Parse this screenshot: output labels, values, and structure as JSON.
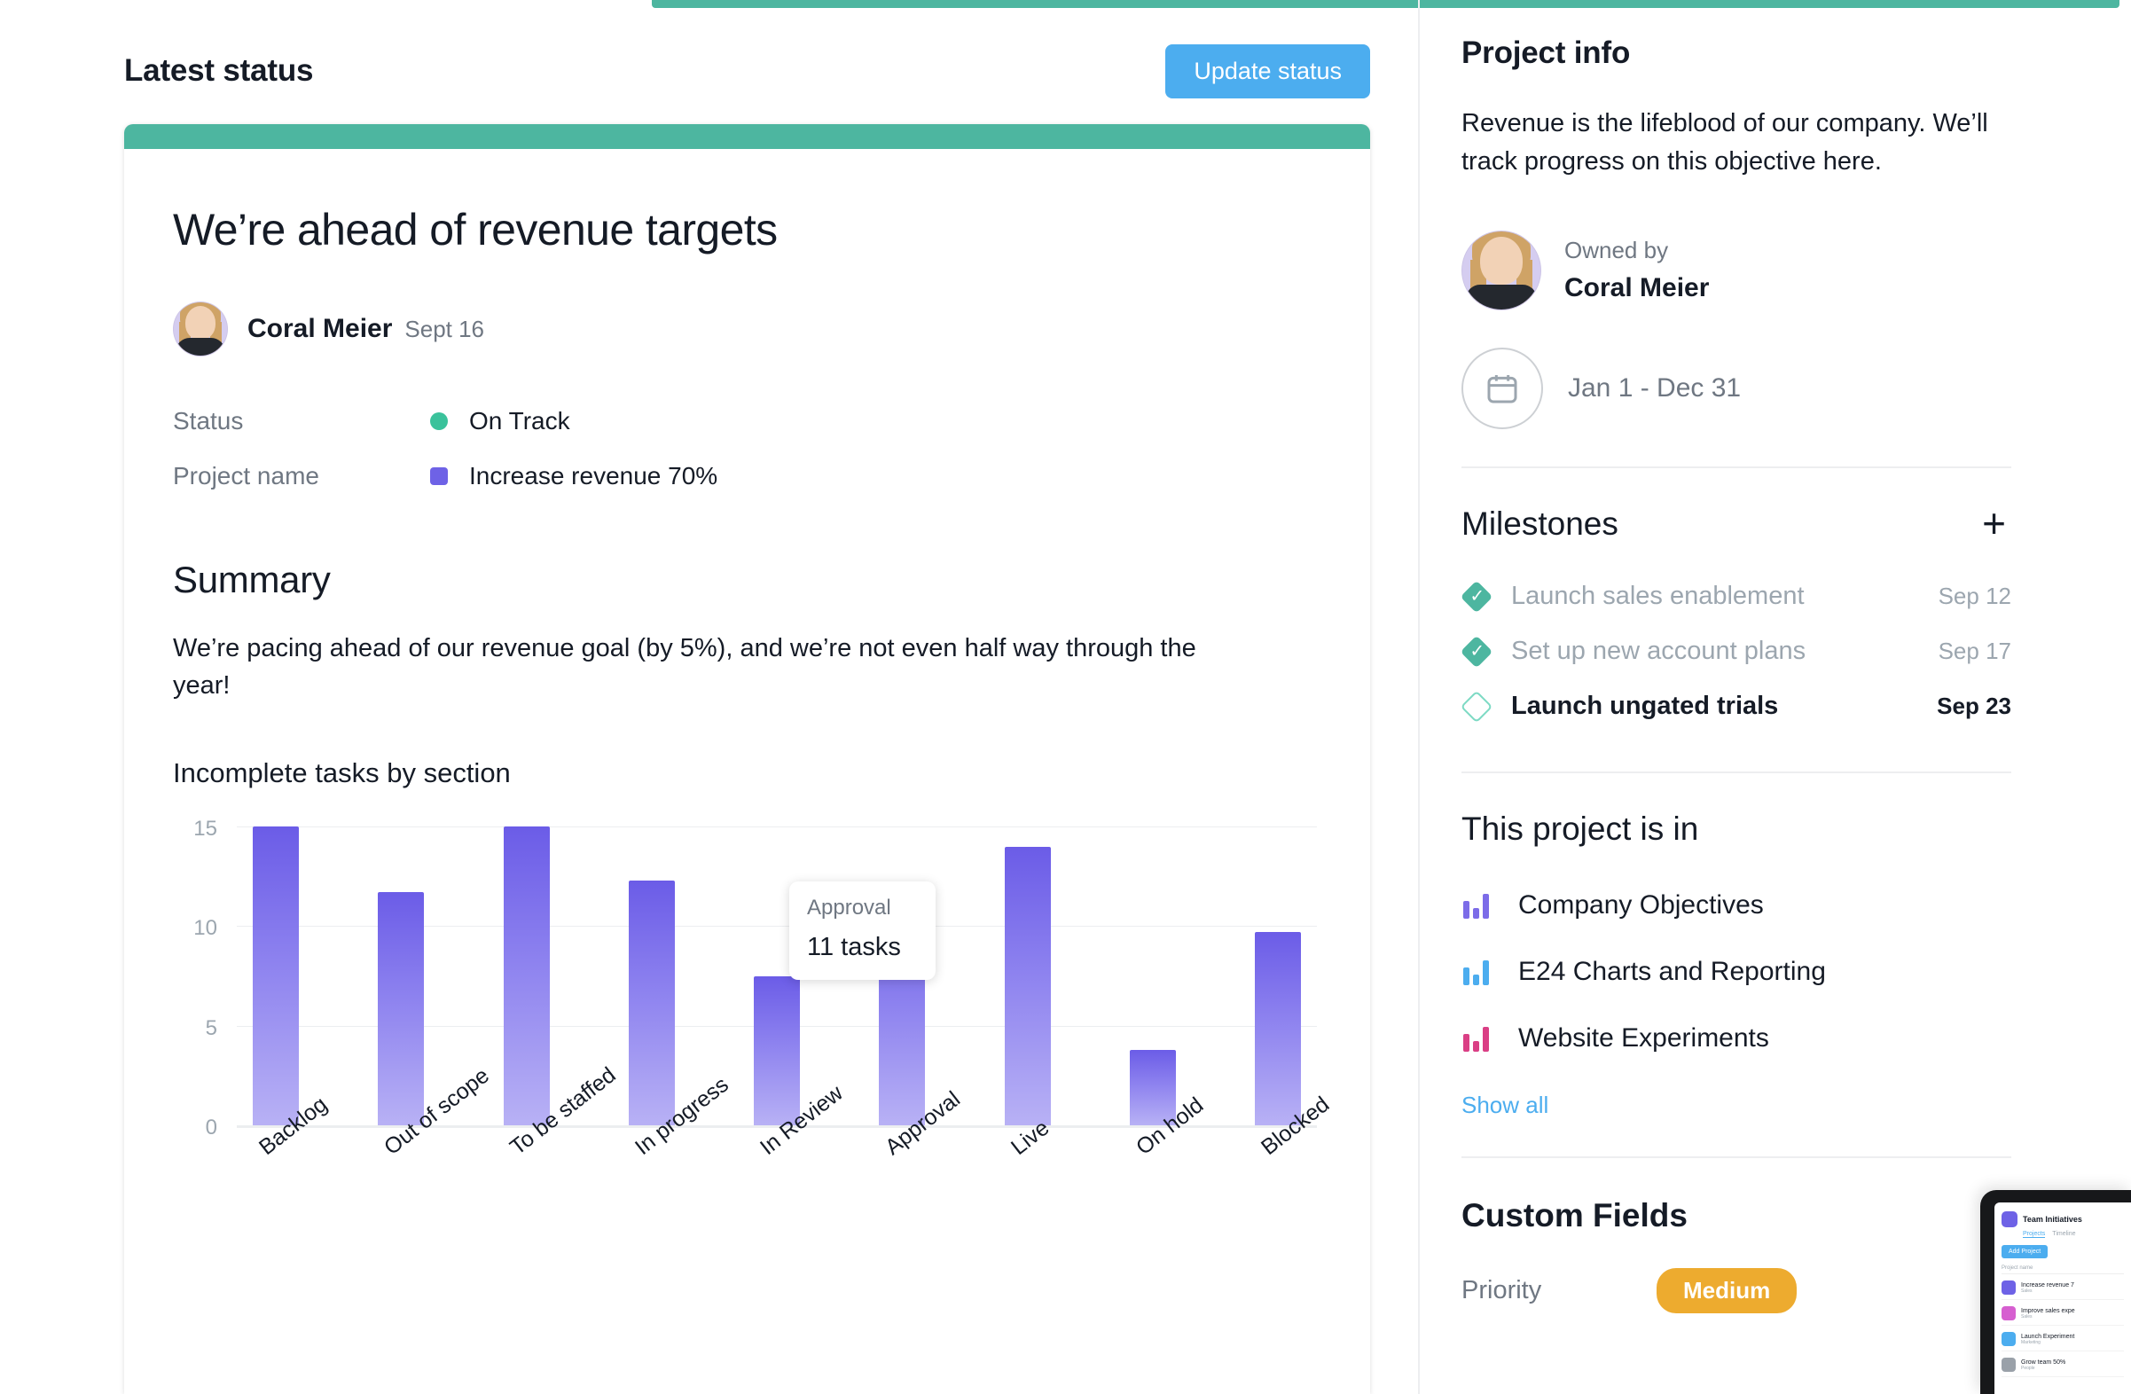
{
  "main": {
    "header_title": "Latest status",
    "update_button": "Update status",
    "card": {
      "title": "We’re ahead of revenue targets",
      "author": "Coral Meier",
      "date": "Sept 16",
      "meta": [
        {
          "label": "Status",
          "value": "On Track",
          "marker": "dot",
          "color": "#3ac29b"
        },
        {
          "label": "Project name",
          "value": "Increase revenue 70%",
          "marker": "square",
          "color": "#6e62e6"
        }
      ],
      "summary_heading": "Summary",
      "summary_text": "We’re pacing ahead of our revenue goal (by 5%), and we’re not even half way through the year!",
      "chart_heading": "Incomplete tasks by section"
    }
  },
  "chart_data": {
    "type": "bar",
    "title": "Incomplete tasks by section",
    "categories": [
      "Backlog",
      "Out of scope",
      "To be staffed",
      "In progress",
      "In Review",
      "Approval",
      "Live",
      "On hold",
      "Blocked"
    ],
    "values": [
      15,
      11.7,
      15,
      12.3,
      7.5,
      11,
      14,
      3.8,
      9.7
    ],
    "ylabel": "",
    "xlabel": "",
    "ylim": [
      0,
      15
    ],
    "yticks": [
      "15",
      "10",
      "5",
      "0"
    ],
    "grid": true,
    "legend": "none",
    "bar_color": "#6b5ce7",
    "tooltip": {
      "label": "Approval",
      "value": "11 tasks"
    }
  },
  "sidebar": {
    "title": "Project info",
    "description": "Revenue is the lifeblood of our company. We’ll track progress on this objective here.",
    "owner_label": "Owned by",
    "owner_name": "Coral Meier",
    "date_range": "Jan 1 - Dec 31",
    "milestones": {
      "heading": "Milestones",
      "add_label": "+",
      "items": [
        {
          "name": "Launch sales enablement",
          "date": "Sep 12",
          "state": "done"
        },
        {
          "name": "Set up new account plans",
          "date": "Sep 17",
          "state": "done"
        },
        {
          "name": "Launch ungated trials",
          "date": "Sep 23",
          "state": "open"
        }
      ]
    },
    "portfolios": {
      "heading": "This project is in",
      "items": [
        {
          "name": "Company Objectives",
          "color": "#7c6ce8"
        },
        {
          "name": "E24 Charts and Reporting",
          "color": "#4cadef"
        },
        {
          "name": "Website Experiments",
          "color": "#da3f85"
        }
      ],
      "show_all": "Show all"
    },
    "custom_fields": {
      "heading": "Custom Fields",
      "rows": [
        {
          "label": "Priority",
          "value": "Medium",
          "color": "#edab2f"
        }
      ]
    }
  },
  "device_preview": {
    "app_title": "Team Initiatives",
    "tabs": [
      "Projects",
      "Timeline"
    ],
    "add_button": "Add Project",
    "column_header": "Project name",
    "rows": [
      {
        "name": "Increase revenue 7",
        "sub": "Sales",
        "color": "#6e62e6"
      },
      {
        "name": "Improve sales expe",
        "sub": "Sales",
        "color": "#d65fd0"
      },
      {
        "name": "Launch Experiment",
        "sub": "Marketing",
        "color": "#4cadef"
      },
      {
        "name": "Grow team 50%",
        "sub": "People",
        "color": "#9aa1a9"
      }
    ]
  }
}
